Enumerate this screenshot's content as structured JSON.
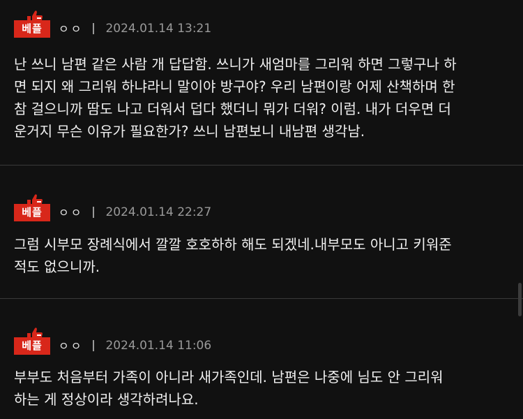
{
  "comments": [
    {
      "badge": "베플",
      "thumb_icon": "thumbs-up-icon",
      "user": "ㅇㅇ",
      "date": "2024.01.14 13:21",
      "text": "난 쓰니 남편 같은 사람 개 답답함. 쓰니가 새엄마를 그리워 하면 그렇구나 하\n면 되지 왜 그리워 하냐라니 말이야 방구야? 우리 남편이랑 어제 산책하며 한\n참 걸으니까 땀도 나고 더워서 덥다 했더니 뭐가 더워? 이럼. 내가 더우면 더\n운거지 무슨 이유가 필요한가? 쓰니 남편보니 내남편 생각남."
    },
    {
      "badge": "베플",
      "thumb_icon": "thumbs-up-icon",
      "user": "ㅇㅇ",
      "date": "2024.01.14 22:27",
      "text": "그럼 시부모 장례식에서 깔깔 호호하하 해도 되겠네.내부모도 아니고 키워준\n적도 없으니까."
    },
    {
      "badge": "베플",
      "thumb_icon": "thumbs-up-icon",
      "user": "ㅇㅇ",
      "date": "2024.01.14 11:06",
      "text": "부부도 처음부터 가족이 아니라 새가족인데. 남편은 나중에 님도 안 그리워\n하는 게 정상이라 생각하려나요."
    }
  ],
  "colors": {
    "background": "#111111",
    "badge": "#d8271a",
    "divider": "#3a3a3a",
    "meta": "#9a9a9a",
    "text": "#f0f0f0"
  }
}
